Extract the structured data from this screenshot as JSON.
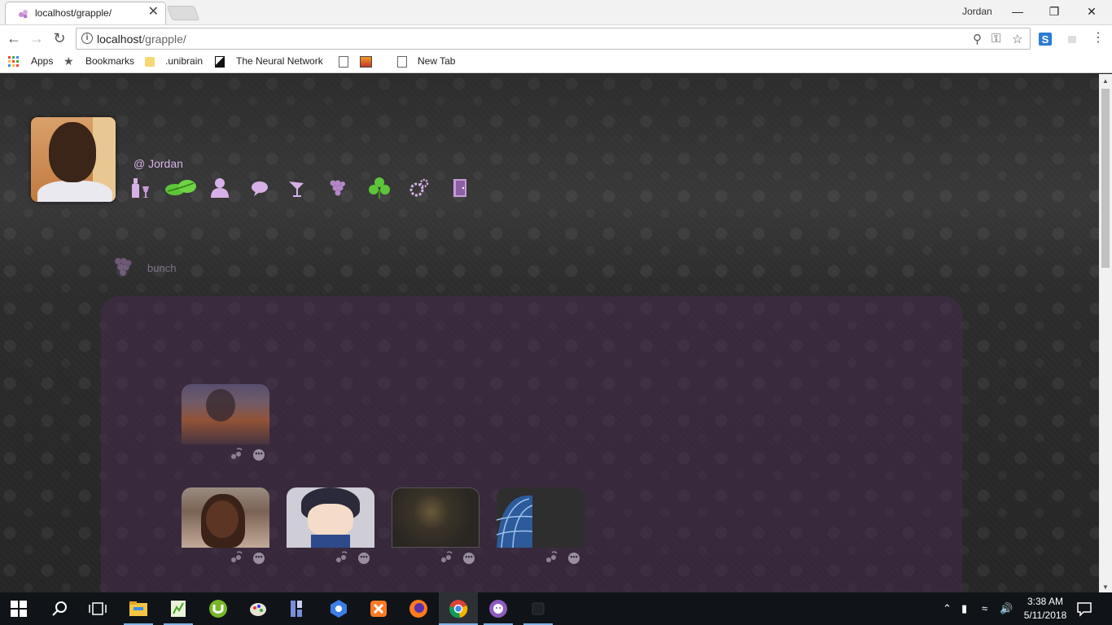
{
  "browser": {
    "tab_title": "localhost/grapple/",
    "tab_close": "✕",
    "profile_name": "Jordan",
    "window_controls": {
      "minimize": "—",
      "maximize": "❐",
      "close": "✕"
    },
    "url_host": "localhost",
    "url_path": "/grapple/",
    "bookmarks": [
      {
        "label": "Apps",
        "icon": "apps-grid-icon"
      },
      {
        "label": "Bookmarks",
        "icon": "star-icon"
      },
      {
        "label": ".unibrain",
        "icon": "folder-icon"
      },
      {
        "label": "The Neural Network",
        "icon": "neural-network-icon"
      },
      {
        "label": "",
        "icon": "page-icon"
      },
      {
        "label": "",
        "icon": "image-icon"
      },
      {
        "label": "New Tab",
        "icon": "page-icon"
      }
    ]
  },
  "profile": {
    "username": "@ Jordan",
    "menu_icons": [
      "wine-bottle-icon",
      "leaf-icon",
      "user-icon",
      "chat-icon",
      "cocktail-icon",
      "grape-icon",
      "clover-icon",
      "settings-gears-icon",
      "logout-door-icon"
    ]
  },
  "section": {
    "label": "bunch",
    "icon": "grape-icon"
  },
  "cards": [
    {
      "photo": "person-on-laptop-photo",
      "more": "•••"
    },
    {
      "photo": "woman-portrait-photo",
      "more": "•••"
    },
    {
      "photo": "anime-character-photo",
      "more": "•••"
    },
    {
      "photo": "dark-abstract-photo",
      "more": "•••"
    },
    {
      "photo": "blue-sphere-photo",
      "more": "•••"
    }
  ],
  "taskbar": {
    "apps": [
      "windows-start-icon",
      "search-icon",
      "task-view-icon",
      "file-explorer-icon",
      "notepad-plus-icon",
      "utorrent-icon",
      "paint-icon",
      "app-icon",
      "network-icon",
      "xampp-icon",
      "firefox-icon",
      "chrome-icon",
      "github-icon",
      "app-icon"
    ],
    "time": "3:38 AM",
    "date": "5/11/2018"
  },
  "colors": {
    "accent": "#d7b3e9",
    "panel": "#4b2d55",
    "leaf_green": "#5ec43a"
  }
}
